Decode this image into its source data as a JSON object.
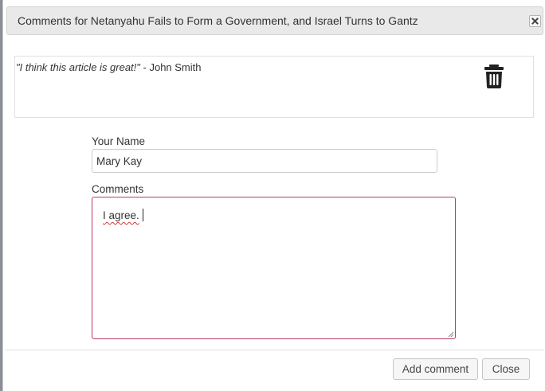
{
  "dialog": {
    "title": "Comments for Netanyahu Fails to Form a Government, and Israel Turns to Gantz",
    "close_icon": "close-icon"
  },
  "existing_comment": {
    "quote": "\"I think this article is great!\"",
    "author_suffix": " - John Smith",
    "delete_icon": "trash-icon"
  },
  "form": {
    "name_label": "Your Name",
    "name_value": "Mary Kay",
    "comments_label": "Comments",
    "comments_value": "I agree."
  },
  "footer": {
    "add_label": "Add comment",
    "close_label": "Close"
  },
  "colors": {
    "focus_border": "#c0395f",
    "titlebar_bg": "#e9e9e9"
  }
}
